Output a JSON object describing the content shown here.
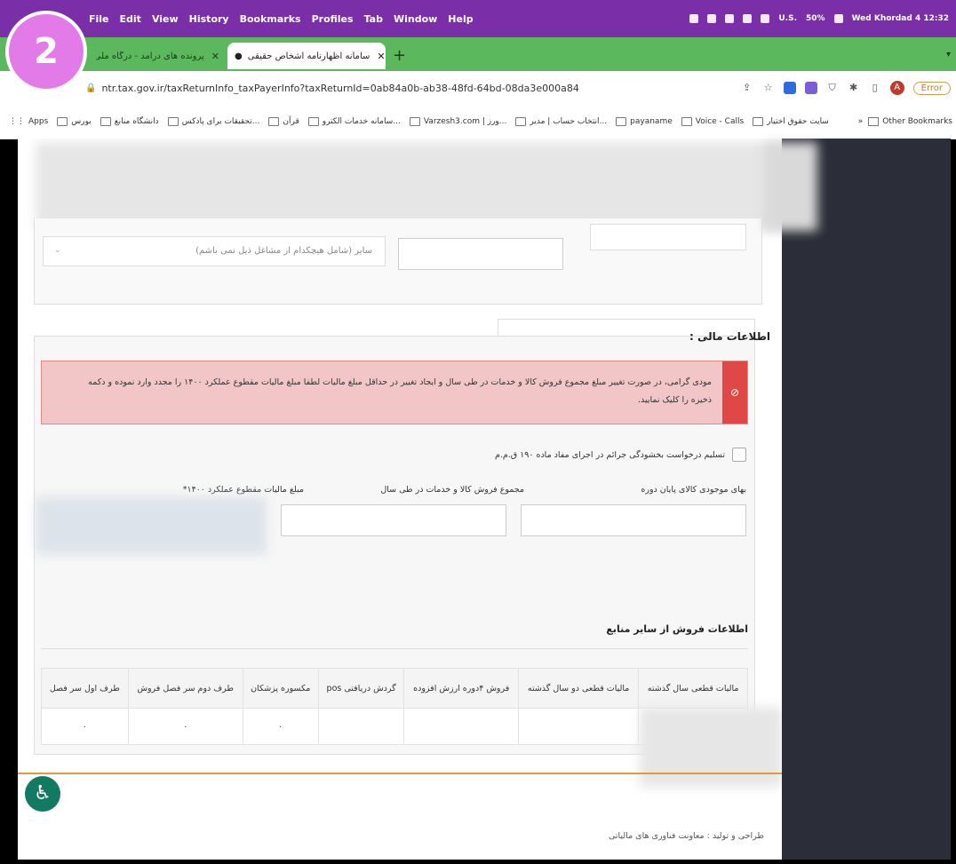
{
  "menubar": {
    "items": [
      "File",
      "Edit",
      "View",
      "History",
      "Bookmarks",
      "Profiles",
      "Tab",
      "Window",
      "Help"
    ],
    "locale": "U.S.",
    "battery": "50%",
    "datetime": "Wed Khordad 4  12:32"
  },
  "badge": {
    "number": "2"
  },
  "tabs": [
    {
      "title": "پرونده های درامد - درگاه ملی خدمات..."
    },
    {
      "title": "سامانه اظهارنامه اشخاص حقیقی"
    }
  ],
  "address": {
    "url": "ntr.tax.gov.ir/taxReturnInfo_taxPayerInfo?taxReturnId=0ab84a0b-ab38-48fd-64bd-08da3e000a84",
    "profile_initial": "A",
    "error_label": "Error"
  },
  "bookmarks": {
    "apps": "Apps",
    "items": [
      "بورس",
      "دانشگاه منابع",
      "تحقیقات برای پادکس...",
      "قرآن",
      "سامانه خدمات الکترو...",
      "Varzesh3.com | ورز...",
      "انتخاب حساب | مدیر...",
      "payaname",
      "Voice - Calls",
      "سایت حقوق اختیار"
    ],
    "other": "Other Bookmarks"
  },
  "form": {
    "occupation_select": "سایر (شامل هیچکدام از مشاغل ذیل نمی باشم)",
    "financial_title": "اطلاعات مالی :",
    "alert_text": "مودی گرامی، در صورت تغییر مبلغ مجموع فروش کالا و خدمات در طی سال و ایجاد تغییر در حداقل مبلغ مالیات لطفا مبلغ مالیات مقطوع عملکرد ۱۴۰۰ را مجدد وارد نموده و دکمه ذخیره را کلیک نمایید.",
    "checkbox_label": "تسلیم درخواست بخشودگی جرائم در اجرای مفاد ماده ۱۹۰ ق.م.م",
    "label_inventory": "بهای موجودی کالای پایان دوره",
    "label_total_sales": "مجموع فروش کالا و خدمات در طی سال",
    "label_fixed_tax": "مبلغ مالیات مقطوع عملکرد ۱۴۰۰*"
  },
  "sales_other": {
    "title": "اطلاعات فروش از سایر منابع",
    "headers": [
      "مالیات قطعی سال گذشته",
      "مالیات قطعی دو سال گذشته",
      "فروش ۴دوره ارزش افزوده",
      "گردش دریافتی pos",
      "مکسوره پزشکان",
      "طرف دوم سر فصل فروش",
      "طرف اول سر فصل"
    ],
    "row": [
      "",
      "",
      "",
      "",
      "۰",
      "۰",
      "۰"
    ]
  },
  "footer": {
    "credit": "طراحی و تولید : معاونت فناوری های مالیاتی"
  }
}
